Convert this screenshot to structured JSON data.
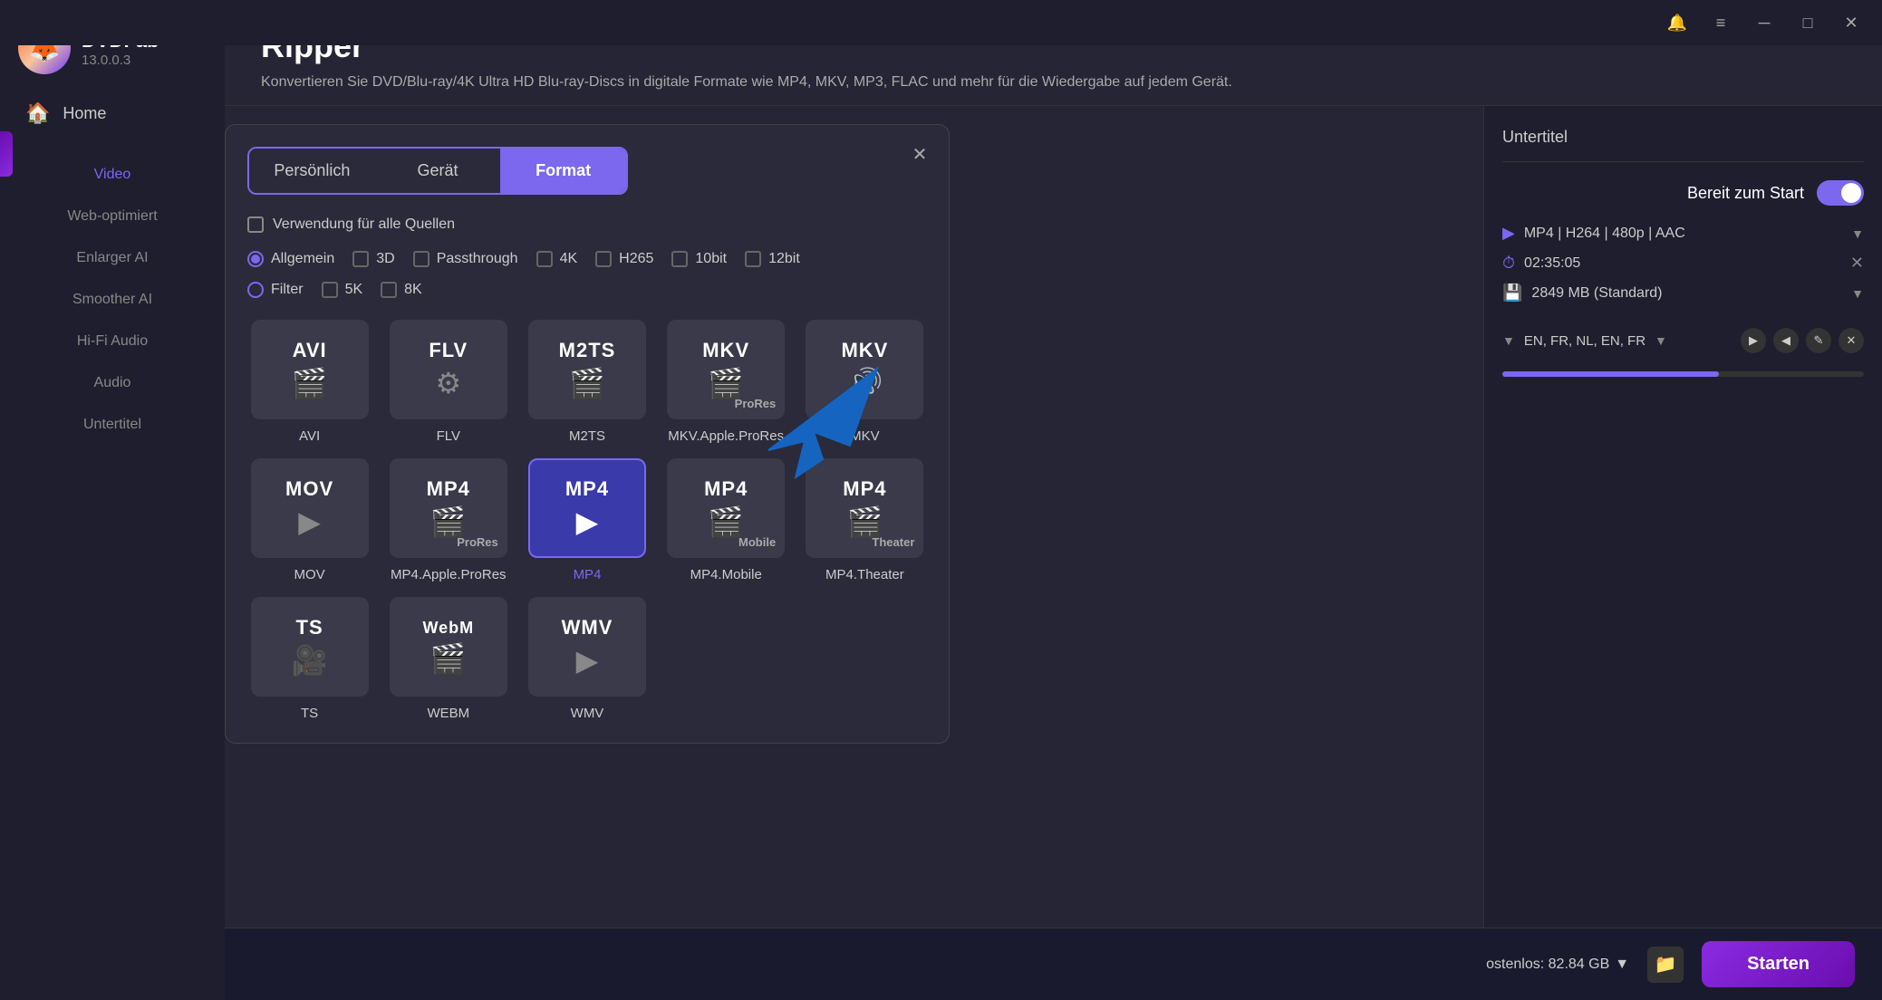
{
  "app": {
    "name": "DVDFab",
    "version": "13.0.0.3",
    "logo_emoji": "🦊"
  },
  "titlebar": {
    "notification_icon": "🔔",
    "menu_icon": "≡",
    "minimize_icon": "─",
    "maximize_icon": "□",
    "close_icon": "✕"
  },
  "sidebar": {
    "home_label": "Home",
    "items": [
      {
        "id": "video",
        "label": "Video",
        "active": true
      },
      {
        "id": "web-optimiert",
        "label": "Web-optimiert",
        "active": false
      },
      {
        "id": "enlarger-ai",
        "label": "Enlarger AI",
        "active": false
      },
      {
        "id": "smoother-ai",
        "label": "Smoother AI",
        "active": false
      },
      {
        "id": "hi-fi-audio",
        "label": "Hi-Fi Audio",
        "active": false
      },
      {
        "id": "audio",
        "label": "Audio",
        "active": false
      },
      {
        "id": "untertitel",
        "label": "Untertitel",
        "active": false
      }
    ]
  },
  "page": {
    "title": "Ripper",
    "subtitle": "Konvertieren Sie DVD/Blu-ray/4K Ultra HD Blu-ray-Discs in digitale Formate wie MP4, MKV, MP3, FLAC und mehr für die Wiedergabe auf jedem Gerät."
  },
  "dialog": {
    "close_icon": "✕",
    "tabs": [
      {
        "id": "persoenlich",
        "label": "Persönlich",
        "active": false
      },
      {
        "id": "geraet",
        "label": "Gerät",
        "active": false
      },
      {
        "id": "format",
        "label": "Format",
        "active": true
      }
    ],
    "use_all_sources_label": "Verwendung für alle Quellen",
    "radio_options": [
      {
        "id": "allgemein",
        "label": "Allgemein",
        "checked": true
      },
      {
        "id": "filter",
        "label": "Filter",
        "checked": false
      }
    ],
    "check_options": [
      {
        "id": "3d",
        "label": "3D",
        "checked": false
      },
      {
        "id": "passthrough",
        "label": "Passthrough",
        "checked": false
      },
      {
        "id": "4k",
        "label": "4K",
        "checked": false
      },
      {
        "id": "h265",
        "label": "H265",
        "checked": false
      },
      {
        "id": "10bit",
        "label": "10bit",
        "checked": false
      },
      {
        "id": "12bit",
        "label": "12bit",
        "checked": false
      },
      {
        "id": "5k",
        "label": "5K",
        "checked": false
      },
      {
        "id": "8k",
        "label": "8K",
        "checked": false
      }
    ],
    "formats": [
      {
        "id": "avi",
        "label": "AVI",
        "sub": "",
        "icon": "🎬",
        "name": "AVI",
        "selected": false
      },
      {
        "id": "flv",
        "label": "FLV",
        "sub": "",
        "icon": "⚙",
        "name": "FLV",
        "selected": false
      },
      {
        "id": "m2ts",
        "label": "M2TS",
        "sub": "",
        "icon": "🎬",
        "name": "M2TS",
        "selected": false
      },
      {
        "id": "mkv-apple-prores",
        "label": "MKV",
        "sub": "ProRes",
        "icon": "🎬",
        "name": "MKV.Apple.ProRes",
        "selected": false
      },
      {
        "id": "mkv",
        "label": "MKV",
        "sub": "",
        "icon": "🔊",
        "name": "MKV",
        "selected": false
      },
      {
        "id": "mov",
        "label": "MOV",
        "sub": "",
        "icon": "▶",
        "name": "MOV",
        "selected": false
      },
      {
        "id": "mp4-apple-prores",
        "label": "MP4",
        "sub": "ProRes",
        "icon": "🎬",
        "name": "MP4.Apple.ProRes",
        "selected": false
      },
      {
        "id": "mp4",
        "label": "MP4",
        "sub": "",
        "icon": "▶",
        "name": "MP4",
        "selected": true
      },
      {
        "id": "mp4-mobile",
        "label": "MP4",
        "sub": "Mobile",
        "icon": "🎬",
        "name": "MP4.Mobile",
        "selected": false
      },
      {
        "id": "mp4-theater",
        "label": "MP4",
        "sub": "Theater",
        "icon": "🎬",
        "name": "MP4.Theater",
        "selected": false
      },
      {
        "id": "ts",
        "label": "TS",
        "sub": "",
        "icon": "🎥",
        "name": "TS",
        "selected": false
      },
      {
        "id": "webm",
        "label": "WebM",
        "sub": "",
        "icon": "🎬",
        "name": "WEBM",
        "selected": false
      },
      {
        "id": "wmv",
        "label": "WMV",
        "sub": "",
        "icon": "▶",
        "name": "WMV",
        "selected": false
      }
    ]
  },
  "right_panel": {
    "subtitle_label": "Untertitel",
    "ready_label": "Bereit zum Start",
    "track": {
      "format": "MP4 | H264 | 480p | AAC",
      "duration": "02:35:05",
      "size": "2849 MB (Standard)"
    },
    "subtitles": "EN, FR, NL, EN, FR",
    "progress": 60
  },
  "bottom_bar": {
    "free_space_label": "ostenlos: 82.84 GB",
    "start_label": "Starten"
  }
}
